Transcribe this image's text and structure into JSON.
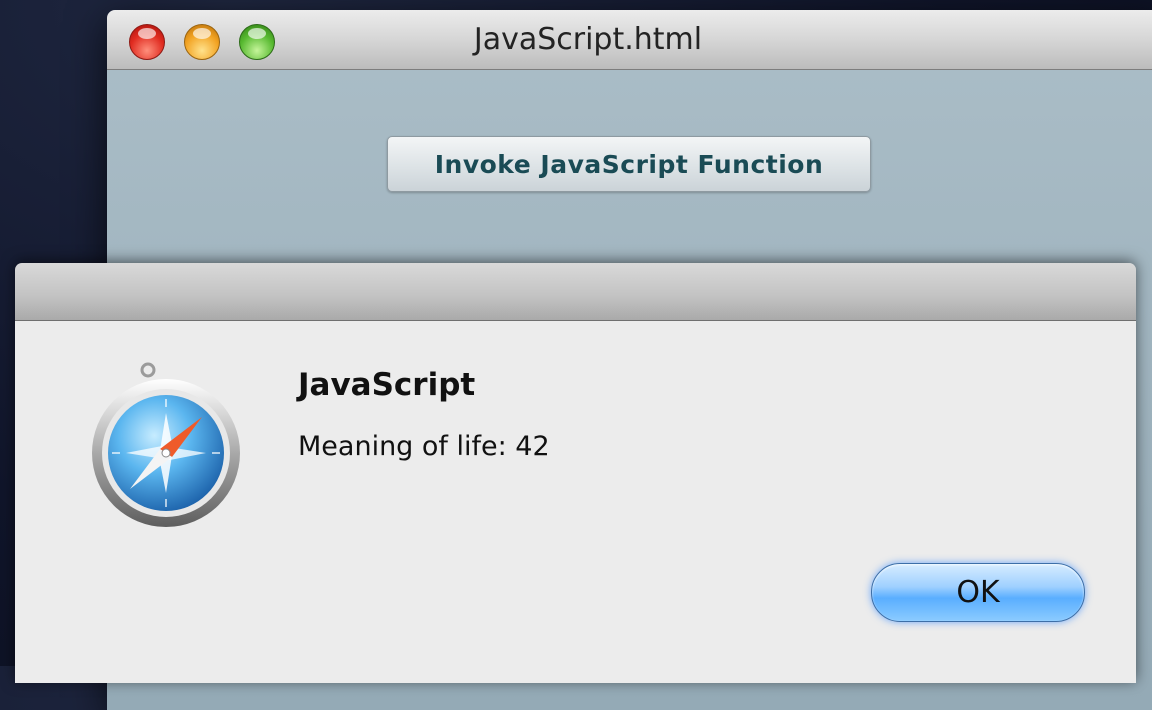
{
  "window": {
    "title": "JavaScript.html",
    "invoke_button_label": "Invoke JavaScript Function"
  },
  "alert": {
    "icon": "safari-compass-icon",
    "title": "JavaScript",
    "message": "Meaning of life: 42",
    "ok_label": "OK"
  },
  "colors": {
    "content_background": "#a9bcc6",
    "dialog_background": "#ececec",
    "ok_button_accent": "#5aaeff"
  }
}
